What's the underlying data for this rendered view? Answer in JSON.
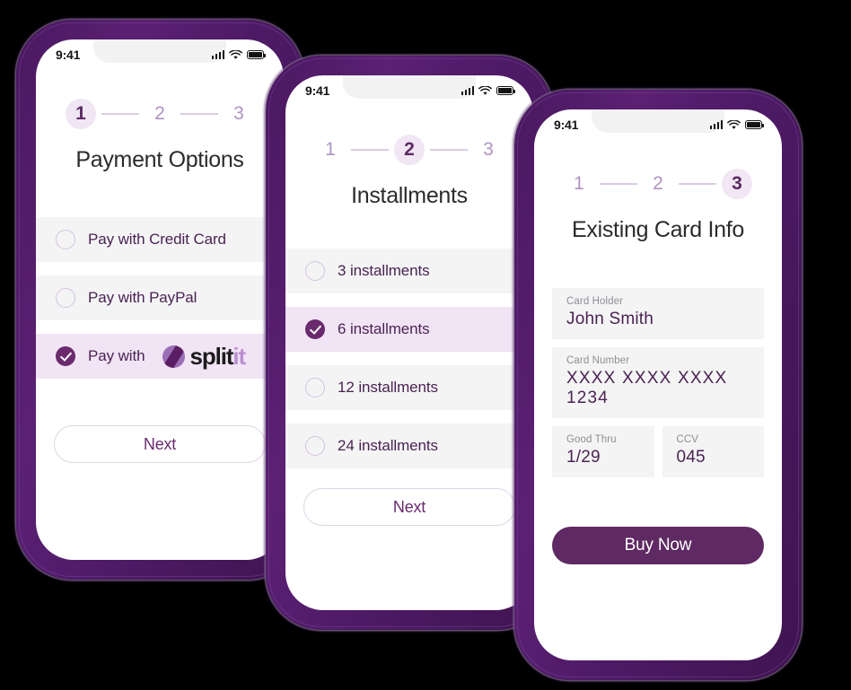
{
  "theme": {
    "background": "#000000",
    "bezel_purple": "#4e1a66",
    "accent_purple": "#6a2a6d",
    "accent_light": "#f1e4f5",
    "step_active_bg": "#f1e6f4",
    "step_inactive_text": "#b093c1",
    "row_bg": "#f4f4f5",
    "text_purple": "#4a2352",
    "label_gray": "#8e8e96"
  },
  "status_bar": {
    "time": "9:41",
    "icons": [
      "signal-bars-icon",
      "wifi-icon",
      "battery-icon"
    ]
  },
  "phones": [
    {
      "id": "payment-options",
      "stepper": {
        "steps": [
          "1",
          "2",
          "3"
        ],
        "active_index": 0
      },
      "title": "Payment Options",
      "options": [
        {
          "label": "Pay with Credit Card",
          "selected": false,
          "logo": null
        },
        {
          "label": "Pay with PayPal",
          "selected": false,
          "logo": null
        },
        {
          "label": "Pay with",
          "selected": true,
          "logo": {
            "word1": "split",
            "word2": "it",
            "mark": "splitit-logo-mark"
          }
        }
      ],
      "primary_button": "Next"
    },
    {
      "id": "installments",
      "stepper": {
        "steps": [
          "1",
          "2",
          "3"
        ],
        "active_index": 1
      },
      "title": "Installments",
      "options": [
        {
          "label": "3 installments",
          "selected": false
        },
        {
          "label": "6 installments",
          "selected": true
        },
        {
          "label": "12 installments",
          "selected": false
        },
        {
          "label": "24 installments",
          "selected": false
        }
      ],
      "primary_button": "Next"
    },
    {
      "id": "existing-card-info",
      "stepper": {
        "steps": [
          "1",
          "2",
          "3"
        ],
        "active_index": 2
      },
      "title": "Existing Card Info",
      "fields": [
        {
          "label": "Card Holder",
          "value": "John Smith"
        },
        {
          "label": "Card Number",
          "value": "XXXX  XXXX  XXXX  1234"
        },
        {
          "label": "Good Thru",
          "value": "1/29"
        },
        {
          "label": "CCV",
          "value": "045"
        }
      ],
      "primary_button": "Buy Now"
    }
  ]
}
